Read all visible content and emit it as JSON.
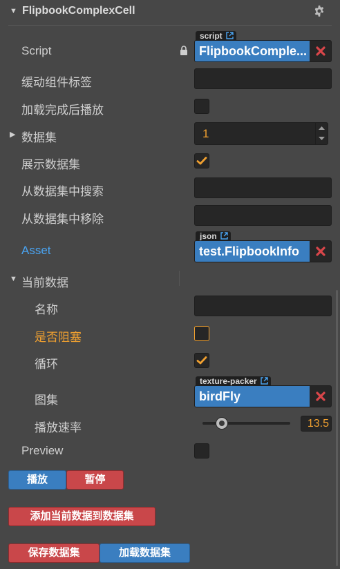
{
  "component": {
    "title": "FlipbookComplexCell",
    "collapse_icon": "triangle-down-icon",
    "settings_icon": "gear-icon"
  },
  "props": {
    "script": {
      "label": "Script",
      "type_tag": "script",
      "value": "FlipbookComple...",
      "lock_icon": "lock-icon"
    },
    "tween_label": {
      "label": "缓动组件标签",
      "value": ""
    },
    "play_on_load": {
      "label": "加载完成后播放",
      "checked": false
    },
    "dataset": {
      "label": "数据集",
      "count": "1"
    },
    "show_dataset": {
      "label": "展示数据集",
      "checked": true
    },
    "search_dataset": {
      "label": "从数据集中搜索",
      "value": ""
    },
    "remove_dataset": {
      "label": "从数据集中移除",
      "value": ""
    },
    "asset": {
      "label": "Asset",
      "type_tag": "json",
      "value": "test.FlipbookInfo"
    },
    "current": {
      "label": "当前数据",
      "name": {
        "label": "名称",
        "value": ""
      },
      "blocking": {
        "label": "是否阻塞",
        "checked": false
      },
      "loop": {
        "label": "循环",
        "checked": true
      },
      "atlas": {
        "label": "图集",
        "type_tag": "texture-packer",
        "value": "birdFly"
      },
      "speed": {
        "label": "播放速率",
        "value": "13.5",
        "slider_fraction": 0.22
      }
    },
    "preview": {
      "label": "Preview",
      "checked": false
    }
  },
  "buttons": {
    "play": "播放",
    "pause": "暂停",
    "add_current": "添加当前数据到数据集",
    "save_dataset": "保存数据集",
    "load_dataset": "加载数据集"
  },
  "colors": {
    "accent_blue": "#3a7ec0",
    "danger_red": "#c9474a",
    "highlight_orange": "#f0a030",
    "link_blue": "#4aa3f0"
  }
}
